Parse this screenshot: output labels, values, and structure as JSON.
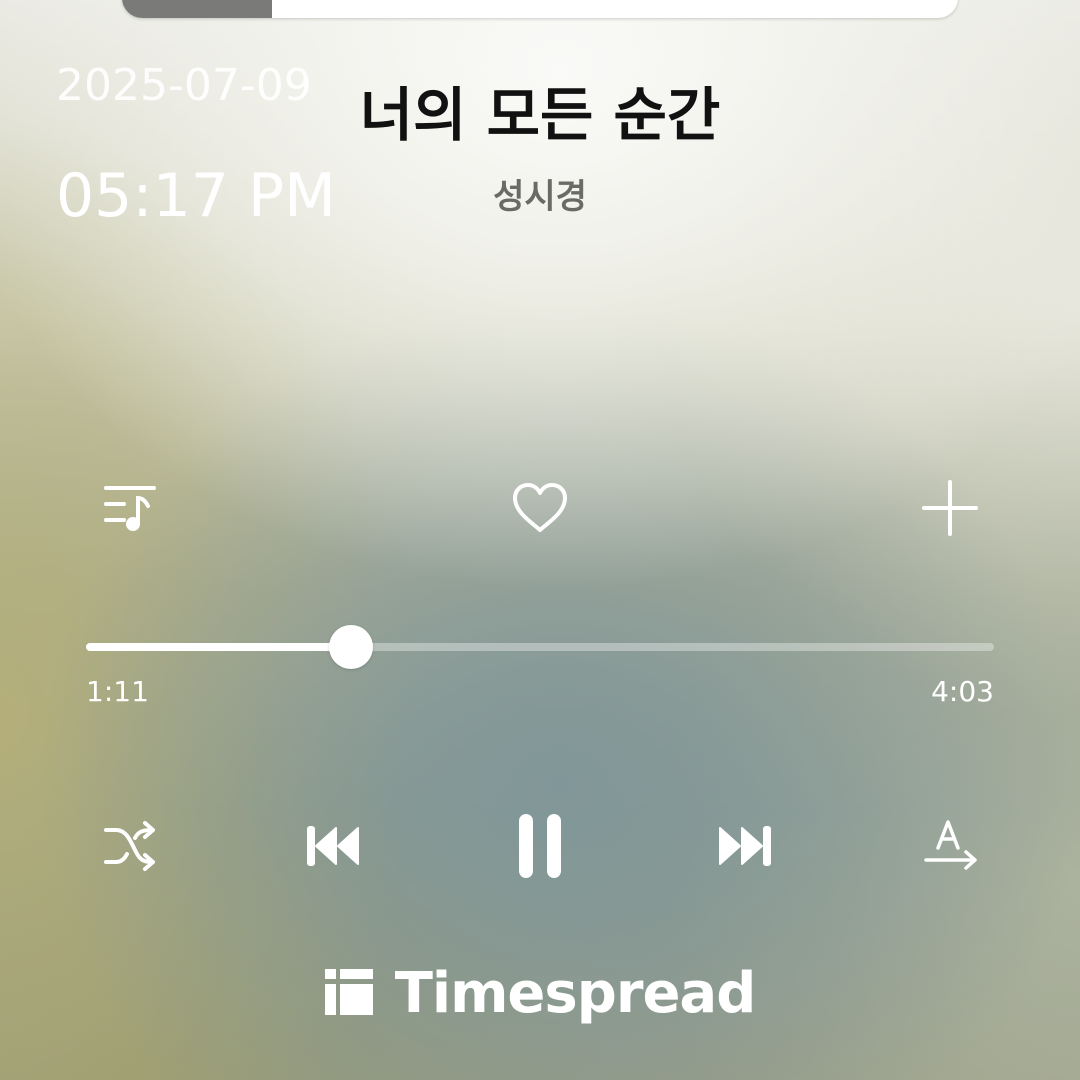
{
  "overlay": {
    "date": "2025-07-09",
    "time": "05:17 PM"
  },
  "song": {
    "title": "너의 모든 순간",
    "artist": "성시경"
  },
  "playback": {
    "elapsed": "1:11",
    "duration": "4:03",
    "progress_fraction": 0.292
  },
  "actions": {
    "icons": [
      "playlist-icon",
      "heart-icon",
      "plus-icon"
    ]
  },
  "controls": {
    "icons": [
      "shuffle-icon",
      "previous-icon",
      "pause-icon",
      "next-icon",
      "lyrics-translate-icon"
    ]
  },
  "watermark": {
    "text": "Timespread"
  },
  "colors": {
    "title": "#111111",
    "artist": "#6b6b66",
    "controls": "#ffffff"
  }
}
